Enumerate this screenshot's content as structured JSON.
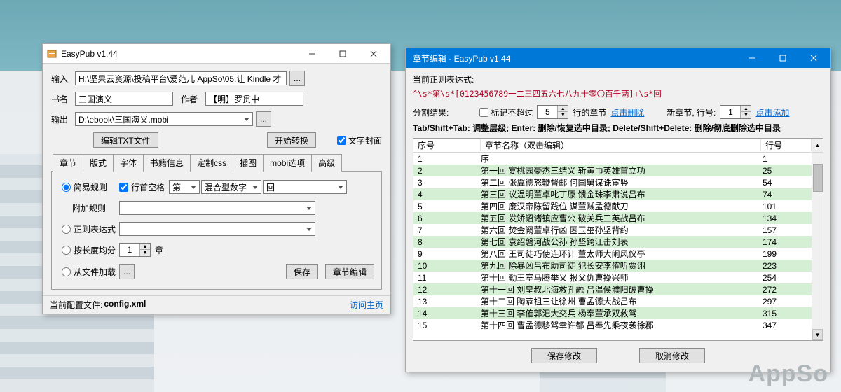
{
  "watermark": "AppSo",
  "window1": {
    "title": "EasyPub v1.44",
    "labels": {
      "input": "输入",
      "book_name": "书名",
      "author": "作者",
      "output": "输出",
      "edit_txt": "编辑TXT文件",
      "start_convert": "开始转换",
      "text_cover": "文字封面"
    },
    "values": {
      "input_path": "H:\\坚果云资源\\投稿平台\\爱范儿 AppSo\\05.让 Kindle 才",
      "book_name": "三国演义",
      "author": "【明】罗贯中",
      "output_path": "D:\\ebook\\三国演义.mobi",
      "text_cover_checked": true,
      "browse_btn": "..."
    },
    "tabs": [
      "章节",
      "版式",
      "字体",
      "书籍信息",
      "定制css",
      "插图",
      "mobi选项",
      "高级"
    ],
    "active_tab": 0,
    "rules": {
      "simple_rule": "简易规则",
      "line_start_space": "行首空格",
      "marker1": "第",
      "number_type": "混合型数字",
      "marker2": "回",
      "extra_rule": "附加规则",
      "regex_rule": "正则表达式",
      "length_split": "按长度均分",
      "length_value": "1",
      "length_unit": "章",
      "from_file": "从文件加载",
      "from_file_btn": "...",
      "save": "保存",
      "chapter_edit": "章节编辑",
      "selected_rule": "simple"
    },
    "status": {
      "config_label": "当前配置文件:",
      "config_file": "config.xml",
      "visit_link": "访问主页"
    }
  },
  "window2": {
    "title": "章节编辑  - EasyPub v1.44",
    "regex_label": "当前正则表达式:",
    "regex_value": "^\\s*第\\s*[0123456789一二三四五六七八九十零〇百千两]+\\s*回",
    "split": {
      "result_label": "分割结果:",
      "mark_limit_label": "标记不超过",
      "mark_limit_value": "5",
      "lines_chapter_suffix": "行的章节",
      "click_delete": "点击删除",
      "new_chapter_label": "新章节, 行号:",
      "new_chapter_value": "1",
      "click_add": "点击添加",
      "mark_limit_checked": false
    },
    "hint": "Tab/Shift+Tab: 调整层级; Enter: 删除/恢复选中目录; Delete/Shift+Delete: 删除/彻底删除选中目录",
    "table": {
      "headers": {
        "seq": "序号",
        "name": "章节名称（双击编辑）",
        "line": "行号"
      },
      "rows": [
        {
          "seq": "1",
          "name": "序",
          "line": "1",
          "even": false
        },
        {
          "seq": "2",
          "name": "第一回  宴桃园豪杰三结义  斩黄巾英雄首立功",
          "line": "25",
          "even": true
        },
        {
          "seq": "3",
          "name": "第二回  张翼德怒鞭督邮  何国舅谋诛宦竖",
          "line": "54",
          "even": false
        },
        {
          "seq": "4",
          "name": "第三回  议温明董卓叱丁原  馈金珠李肃说吕布",
          "line": "74",
          "even": true
        },
        {
          "seq": "5",
          "name": "第四回  废汉帝陈留践位  谋董贼孟德献刀",
          "line": "101",
          "even": false
        },
        {
          "seq": "6",
          "name": "第五回  发矫诏诸镇应曹公  破关兵三英战吕布",
          "line": "134",
          "even": true
        },
        {
          "seq": "7",
          "name": "第六回  焚金阙董卓行凶  匿玉玺孙坚背约",
          "line": "157",
          "even": false
        },
        {
          "seq": "8",
          "name": "第七回  袁绍磐河战公孙  孙坚跨江击刘表",
          "line": "174",
          "even": true
        },
        {
          "seq": "9",
          "name": "第八回  王司徒巧使连环计  董太师大闹风仪亭",
          "line": "199",
          "even": false
        },
        {
          "seq": "10",
          "name": "第九回  除暴凶吕布助司徒  犯长安李傕听贾诩",
          "line": "223",
          "even": true
        },
        {
          "seq": "11",
          "name": "第十回  勤王室马腾举义  报父仇曹操兴师",
          "line": "254",
          "even": false
        },
        {
          "seq": "12",
          "name": "第十一回  刘皇叔北海救孔融  吕温侯濮阳破曹操",
          "line": "272",
          "even": true
        },
        {
          "seq": "13",
          "name": "第十二回  陶恭祖三让徐州  曹孟德大战吕布",
          "line": "297",
          "even": false
        },
        {
          "seq": "14",
          "name": "第十三回  李傕郭汜大交兵  杨奉董承双救驾",
          "line": "315",
          "even": true
        },
        {
          "seq": "15",
          "name": "第十四回  曹孟德移驾幸许都  吕奉先乘夜袭徐郡",
          "line": "347",
          "even": false
        }
      ]
    },
    "buttons": {
      "save_changes": "保存修改",
      "cancel_changes": "取消修改"
    }
  }
}
